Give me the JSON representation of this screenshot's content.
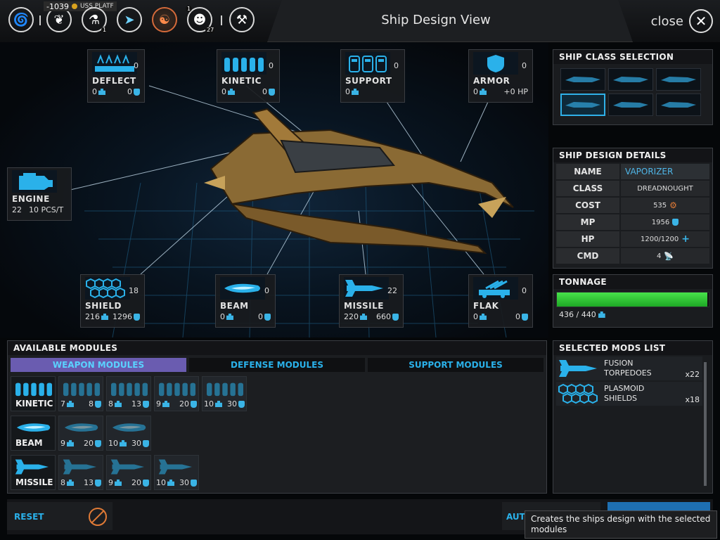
{
  "topbar": {
    "title": "Ship Design View",
    "close_label": "close",
    "credits": "-1039",
    "ship_name_truncated": "USS PLATF",
    "badge_research": "1",
    "badge_pop_a": "1",
    "badge_pop_b": "27"
  },
  "slots": {
    "deflect": {
      "name": "DEFLECT",
      "count": "0",
      "weight": "0",
      "force": "0"
    },
    "kinetic": {
      "name": "KINETIC",
      "count": "0",
      "weight": "0",
      "force": "0"
    },
    "support": {
      "name": "SUPPORT",
      "count": "0",
      "weight": "0"
    },
    "armor": {
      "name": "ARMOR",
      "count": "0",
      "weight": "0",
      "hp": "+0 HP"
    },
    "engine": {
      "name": "ENGINE",
      "value": "22",
      "rate": "10 PCS/T"
    },
    "shield": {
      "name": "SHIELD",
      "count": "18",
      "weight": "216",
      "force": "1296"
    },
    "beam": {
      "name": "BEAM",
      "count": "0",
      "weight": "0",
      "force": "0"
    },
    "missile": {
      "name": "MISSILE",
      "count": "22",
      "weight": "220",
      "force": "660"
    },
    "flak": {
      "name": "FLAK",
      "count": "0",
      "weight": "0",
      "force": "0"
    }
  },
  "class_selection": {
    "title": "SHIP CLASS SELECTION",
    "selected_index": 3
  },
  "details": {
    "title": "SHIP DESIGN DETAILS",
    "name_label": "NAME",
    "name_value": "VAPORIZER",
    "class_label": "CLASS",
    "class_value": "DREADNOUGHT",
    "cost_label": "COST",
    "cost_value": "535",
    "mp_label": "MP",
    "mp_value": "1956",
    "hp_label": "HP",
    "hp_value": "1200/1200",
    "cmd_label": "CMD",
    "cmd_value": "4"
  },
  "tonnage": {
    "title": "TONNAGE",
    "text": "436 / 440",
    "used": 436,
    "max": 440
  },
  "modules": {
    "title": "AVAILABLE MODULES",
    "tabs": [
      "WEAPON MODULES",
      "DEFENSE MODULES",
      "SUPPORT MODULES"
    ],
    "active_tab": 0,
    "rows": [
      {
        "label": "KINETIC",
        "items": [
          {
            "w": "7",
            "f": "8"
          },
          {
            "w": "8",
            "f": "13"
          },
          {
            "w": "9",
            "f": "20"
          },
          {
            "w": "10",
            "f": "30"
          }
        ]
      },
      {
        "label": "BEAM",
        "items": [
          {
            "w": "9",
            "f": "20"
          },
          {
            "w": "10",
            "f": "30"
          }
        ]
      },
      {
        "label": "MISSILE",
        "items": [
          {
            "w": "8",
            "f": "13"
          },
          {
            "w": "9",
            "f": "20"
          },
          {
            "w": "10",
            "f": "30"
          }
        ]
      }
    ]
  },
  "selected": {
    "title": "SELECTED MODS LIST",
    "items": [
      {
        "name": "FUSION TORPEDOES",
        "qty": "x22"
      },
      {
        "name": "PLASMOID SHIELDS",
        "qty": "x18"
      }
    ]
  },
  "bottom": {
    "reset_label": "RESET",
    "auto_label": "AUT",
    "tooltip": "Creates the ships design with the selected modules"
  },
  "colors": {
    "accent": "#2ab1ea",
    "tonnage_fill": "#2fd23a",
    "tab_active": "#6a5cb0",
    "cost_icon": "#e07a36"
  }
}
